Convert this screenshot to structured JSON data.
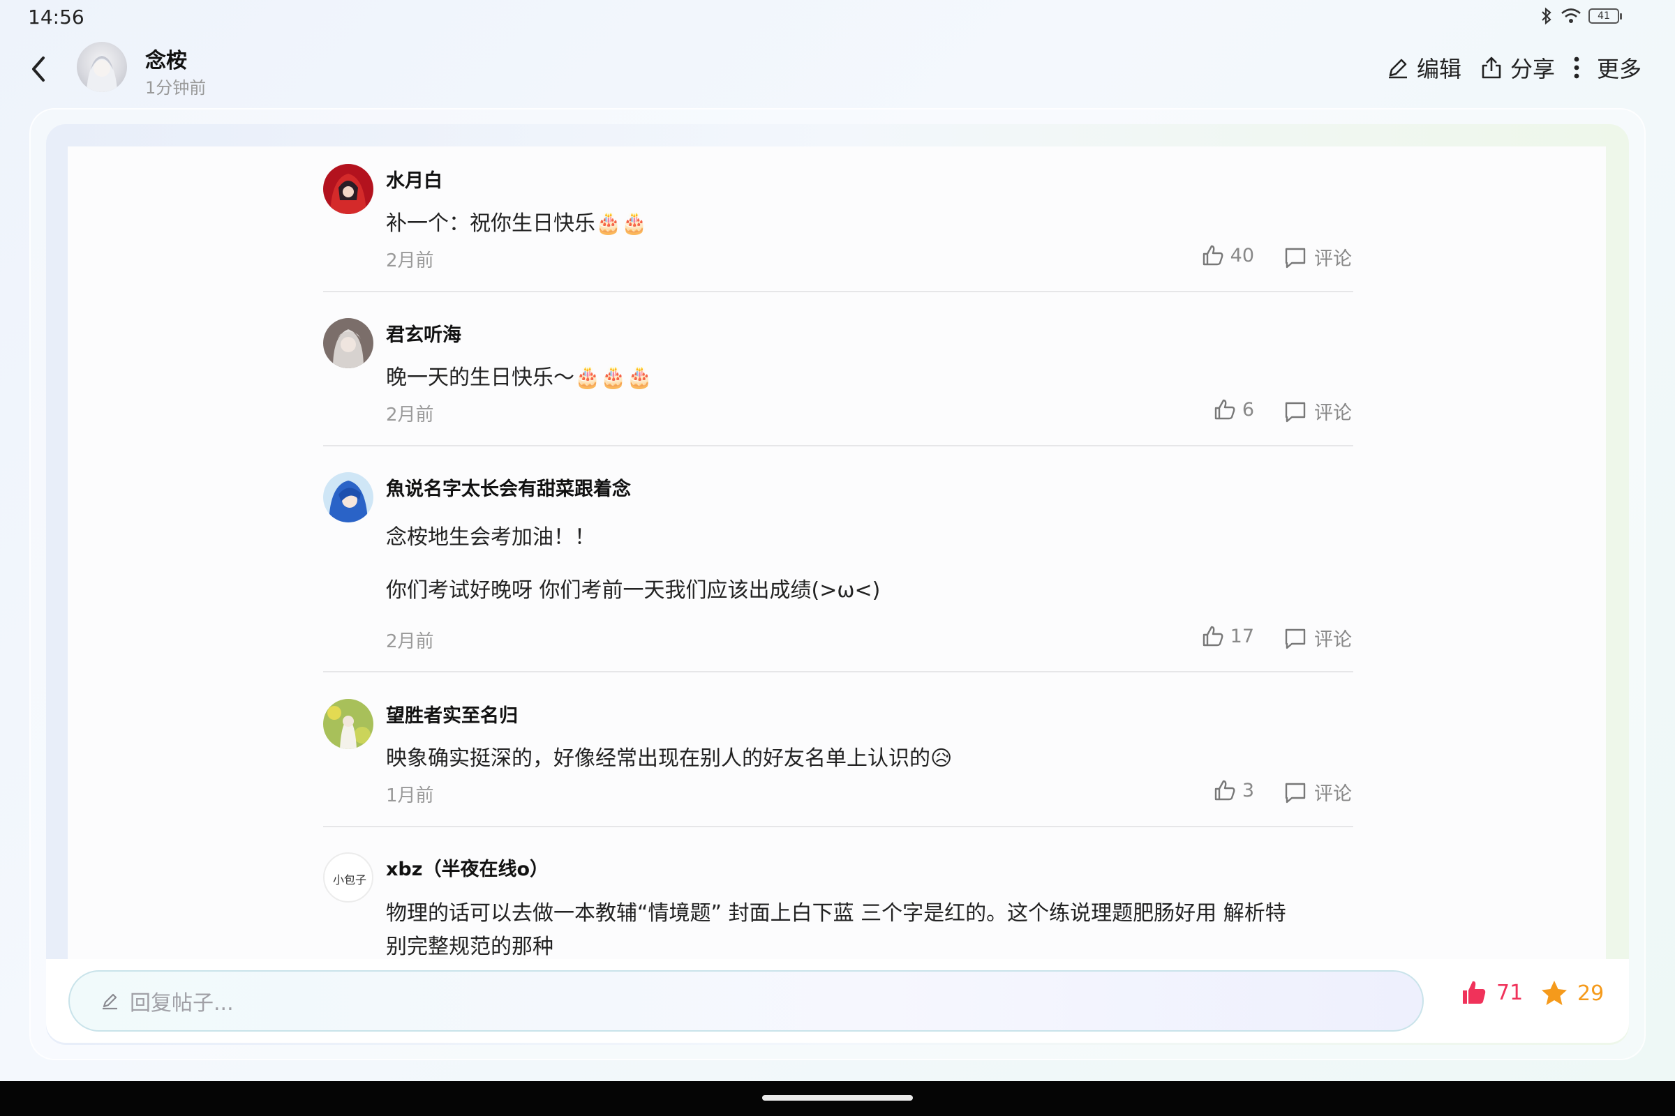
{
  "status_bar": {
    "time": "14:56",
    "battery": "41"
  },
  "header": {
    "author_name": "念桉",
    "post_time": "1分钟前",
    "actions": {
      "edit": "编辑",
      "share": "分享",
      "more": "更多"
    }
  },
  "comments": [
    {
      "name": "水月白",
      "lines": [
        "补一个：祝你生日快乐🎂🎂"
      ],
      "time": "2月前",
      "likes": "40",
      "reply_label": "评论"
    },
    {
      "name": "君玄听海",
      "lines": [
        "晚一天的生日快乐～🎂🎂🎂"
      ],
      "time": "2月前",
      "likes": "6",
      "reply_label": "评论"
    },
    {
      "name": "魚说名字太长会有甜菜跟着念",
      "lines": [
        "念桉地生会考加油！！",
        "你们考试好晚呀 你们考前一天我们应该出成绩(>ω<)"
      ],
      "time": "2月前",
      "likes": "17",
      "reply_label": "评论"
    },
    {
      "name": "望胜者实至名归",
      "lines": [
        "映象确实挺深的，好像经常出现在别人的好友名单上认识的😥"
      ],
      "time": "1月前",
      "likes": "3",
      "reply_label": "评论"
    },
    {
      "name": "xbz（半夜在线o）",
      "lines": [
        "物理的话可以去做一本教辅“情境题” 封面上白下蓝 三个字是红的。这个练说理题肥肠好用 解析特",
        "别完整规范的那种"
      ],
      "avatar_text": "小包子"
    }
  ],
  "bottom_bar": {
    "placeholder": "回复帖子...",
    "like_count": "71",
    "favorite_count": "29"
  },
  "colors": {
    "like": "#f0325a",
    "favorite": "#f59a1b",
    "muted": "#888888"
  },
  "icons": [
    "back-arrow-icon",
    "edit-icon",
    "share-icon",
    "more-dots-icon",
    "thumb-up-icon",
    "comment-icon",
    "pencil-icon",
    "star-icon",
    "bluetooth-icon",
    "wifi-icon",
    "battery-icon"
  ]
}
